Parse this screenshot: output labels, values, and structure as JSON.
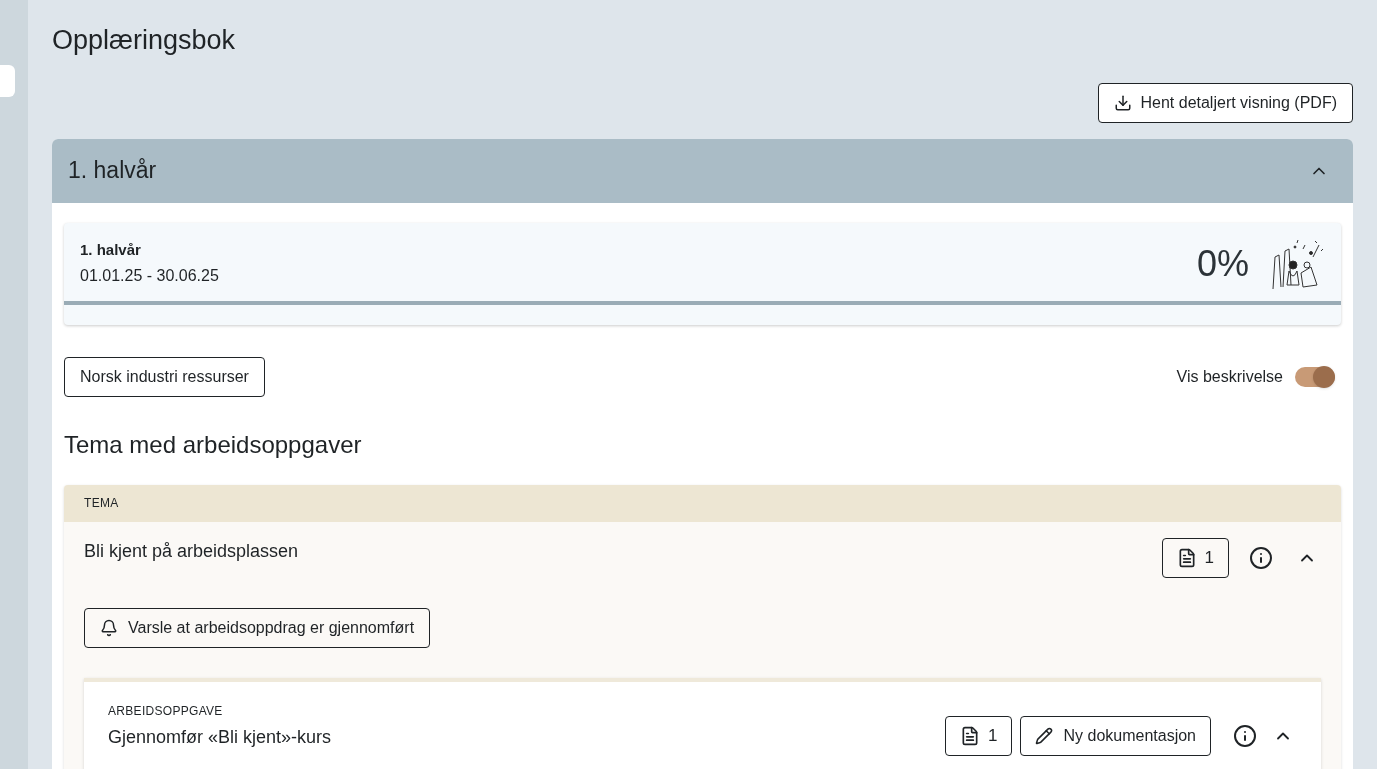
{
  "page": {
    "title": "Opplæringsbok"
  },
  "download_button": {
    "label": "Hent detaljert visning (PDF)"
  },
  "period": {
    "title": "1. halvår",
    "expanded": true,
    "summary": {
      "title": "1. halvår",
      "dates": "01.01.25 - 30.06.25",
      "percent": "0%",
      "level": 0
    }
  },
  "resources_button": {
    "label": "Norsk industri ressurser"
  },
  "description_toggle": {
    "label": "Vis beskrivelse",
    "on": true
  },
  "section_title": "Tema med arbeidsoppgaver",
  "theme": {
    "kind_label": "TEMA",
    "title": "Bli kjent på arbeidsplassen",
    "doc_count": "1",
    "expanded": true,
    "notify_button": {
      "label": "Varsle at arbeidsoppdrag er gjennomført"
    },
    "task": {
      "kind_label": "ARBEIDSOPPGAVE",
      "title": "Gjennomfør «Bli kjent»-kurs",
      "doc_count": "1",
      "new_doc_button": "Ny dokumentasjon",
      "expanded": true
    }
  }
}
